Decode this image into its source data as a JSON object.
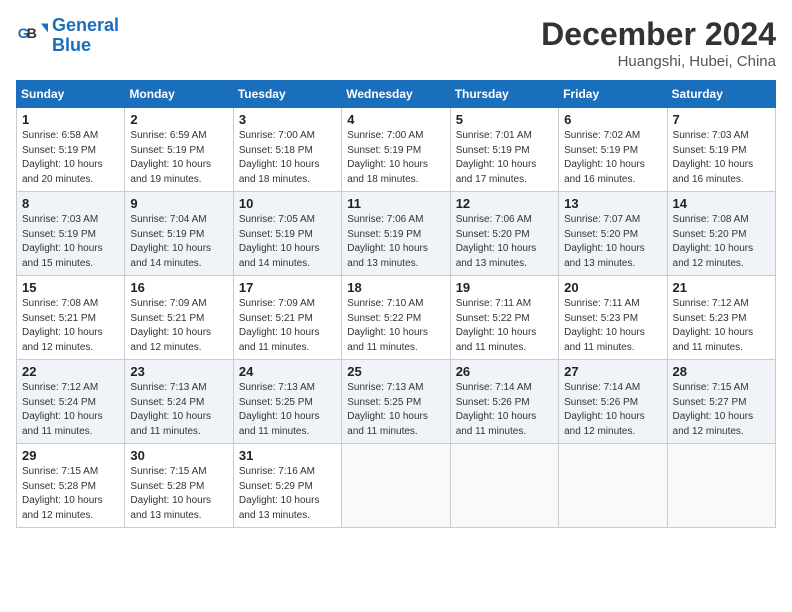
{
  "logo": {
    "line1": "General",
    "line2": "Blue"
  },
  "title": "December 2024",
  "subtitle": "Huangshi, Hubei, China",
  "weekdays": [
    "Sunday",
    "Monday",
    "Tuesday",
    "Wednesday",
    "Thursday",
    "Friday",
    "Saturday"
  ],
  "weeks": [
    [
      {
        "day": "1",
        "info": "Sunrise: 6:58 AM\nSunset: 5:19 PM\nDaylight: 10 hours\nand 20 minutes."
      },
      {
        "day": "2",
        "info": "Sunrise: 6:59 AM\nSunset: 5:19 PM\nDaylight: 10 hours\nand 19 minutes."
      },
      {
        "day": "3",
        "info": "Sunrise: 7:00 AM\nSunset: 5:18 PM\nDaylight: 10 hours\nand 18 minutes."
      },
      {
        "day": "4",
        "info": "Sunrise: 7:00 AM\nSunset: 5:19 PM\nDaylight: 10 hours\nand 18 minutes."
      },
      {
        "day": "5",
        "info": "Sunrise: 7:01 AM\nSunset: 5:19 PM\nDaylight: 10 hours\nand 17 minutes."
      },
      {
        "day": "6",
        "info": "Sunrise: 7:02 AM\nSunset: 5:19 PM\nDaylight: 10 hours\nand 16 minutes."
      },
      {
        "day": "7",
        "info": "Sunrise: 7:03 AM\nSunset: 5:19 PM\nDaylight: 10 hours\nand 16 minutes."
      }
    ],
    [
      {
        "day": "8",
        "info": "Sunrise: 7:03 AM\nSunset: 5:19 PM\nDaylight: 10 hours\nand 15 minutes."
      },
      {
        "day": "9",
        "info": "Sunrise: 7:04 AM\nSunset: 5:19 PM\nDaylight: 10 hours\nand 14 minutes."
      },
      {
        "day": "10",
        "info": "Sunrise: 7:05 AM\nSunset: 5:19 PM\nDaylight: 10 hours\nand 14 minutes."
      },
      {
        "day": "11",
        "info": "Sunrise: 7:06 AM\nSunset: 5:19 PM\nDaylight: 10 hours\nand 13 minutes."
      },
      {
        "day": "12",
        "info": "Sunrise: 7:06 AM\nSunset: 5:20 PM\nDaylight: 10 hours\nand 13 minutes."
      },
      {
        "day": "13",
        "info": "Sunrise: 7:07 AM\nSunset: 5:20 PM\nDaylight: 10 hours\nand 13 minutes."
      },
      {
        "day": "14",
        "info": "Sunrise: 7:08 AM\nSunset: 5:20 PM\nDaylight: 10 hours\nand 12 minutes."
      }
    ],
    [
      {
        "day": "15",
        "info": "Sunrise: 7:08 AM\nSunset: 5:21 PM\nDaylight: 10 hours\nand 12 minutes."
      },
      {
        "day": "16",
        "info": "Sunrise: 7:09 AM\nSunset: 5:21 PM\nDaylight: 10 hours\nand 12 minutes."
      },
      {
        "day": "17",
        "info": "Sunrise: 7:09 AM\nSunset: 5:21 PM\nDaylight: 10 hours\nand 11 minutes."
      },
      {
        "day": "18",
        "info": "Sunrise: 7:10 AM\nSunset: 5:22 PM\nDaylight: 10 hours\nand 11 minutes."
      },
      {
        "day": "19",
        "info": "Sunrise: 7:11 AM\nSunset: 5:22 PM\nDaylight: 10 hours\nand 11 minutes."
      },
      {
        "day": "20",
        "info": "Sunrise: 7:11 AM\nSunset: 5:23 PM\nDaylight: 10 hours\nand 11 minutes."
      },
      {
        "day": "21",
        "info": "Sunrise: 7:12 AM\nSunset: 5:23 PM\nDaylight: 10 hours\nand 11 minutes."
      }
    ],
    [
      {
        "day": "22",
        "info": "Sunrise: 7:12 AM\nSunset: 5:24 PM\nDaylight: 10 hours\nand 11 minutes."
      },
      {
        "day": "23",
        "info": "Sunrise: 7:13 AM\nSunset: 5:24 PM\nDaylight: 10 hours\nand 11 minutes."
      },
      {
        "day": "24",
        "info": "Sunrise: 7:13 AM\nSunset: 5:25 PM\nDaylight: 10 hours\nand 11 minutes."
      },
      {
        "day": "25",
        "info": "Sunrise: 7:13 AM\nSunset: 5:25 PM\nDaylight: 10 hours\nand 11 minutes."
      },
      {
        "day": "26",
        "info": "Sunrise: 7:14 AM\nSunset: 5:26 PM\nDaylight: 10 hours\nand 11 minutes."
      },
      {
        "day": "27",
        "info": "Sunrise: 7:14 AM\nSunset: 5:26 PM\nDaylight: 10 hours\nand 12 minutes."
      },
      {
        "day": "28",
        "info": "Sunrise: 7:15 AM\nSunset: 5:27 PM\nDaylight: 10 hours\nand 12 minutes."
      }
    ],
    [
      {
        "day": "29",
        "info": "Sunrise: 7:15 AM\nSunset: 5:28 PM\nDaylight: 10 hours\nand 12 minutes."
      },
      {
        "day": "30",
        "info": "Sunrise: 7:15 AM\nSunset: 5:28 PM\nDaylight: 10 hours\nand 13 minutes."
      },
      {
        "day": "31",
        "info": "Sunrise: 7:16 AM\nSunset: 5:29 PM\nDaylight: 10 hours\nand 13 minutes."
      },
      null,
      null,
      null,
      null
    ]
  ]
}
